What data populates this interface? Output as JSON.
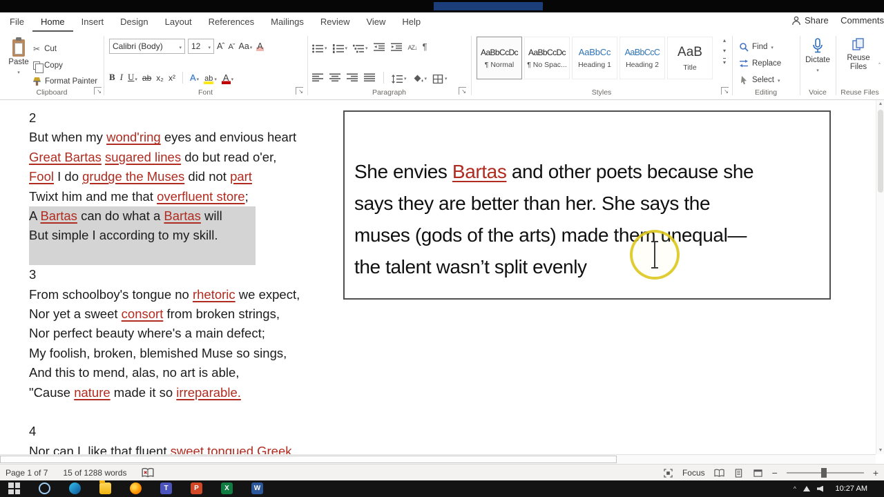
{
  "colors": {
    "red_text": "#b02b20",
    "selection_gray": "#d4d4d4",
    "circle_yellow": "#ddc81f",
    "heading_blue": "#2e74b5"
  },
  "ribbon": {
    "tabs": [
      {
        "label": "File"
      },
      {
        "label": "Home",
        "active": true
      },
      {
        "label": "Insert"
      },
      {
        "label": "Design"
      },
      {
        "label": "Layout"
      },
      {
        "label": "References"
      },
      {
        "label": "Mailings"
      },
      {
        "label": "Review"
      },
      {
        "label": "View"
      },
      {
        "label": "Help"
      }
    ],
    "share_label": "Share",
    "comments_label": "Comments",
    "group_labels": {
      "clipboard": "Clipboard",
      "font": "Font",
      "paragraph": "Paragraph",
      "styles": "Styles",
      "editing": "Editing",
      "voice": "Voice",
      "reuse": "Reuse Files"
    },
    "clipboard": {
      "paste": "Paste",
      "cut": "Cut",
      "copy": "Copy",
      "format_painter": "Format Painter"
    },
    "font": {
      "name": "Calibri (Body)",
      "size": "12"
    },
    "styles": [
      {
        "sample": "AaBbCcDc",
        "label": "¶ Normal",
        "kind": "normal",
        "selected": true
      },
      {
        "sample": "AaBbCcDc",
        "label": "¶ No Spac...",
        "kind": "normal"
      },
      {
        "sample": "AaBbCc",
        "label": "Heading 1",
        "kind": "h1"
      },
      {
        "sample": "AaBbCcC",
        "label": "Heading 2",
        "kind": "h2"
      },
      {
        "sample": "AaB",
        "label": "Title",
        "kind": "title"
      }
    ],
    "editing": {
      "find": "Find",
      "replace": "Replace",
      "select": "Select"
    },
    "voice": {
      "dictate": "Dictate"
    },
    "reuse": {
      "label": "Reuse Files"
    }
  },
  "document": {
    "lines": [
      {
        "segments": [
          {
            "t": "2"
          }
        ]
      },
      {
        "segments": [
          {
            "t": "But when my "
          },
          {
            "t": "wond'ring",
            "red": true
          },
          {
            "t": " eyes and envious heart"
          }
        ]
      },
      {
        "segments": [
          {
            "t": "Great Bartas",
            "red": true
          },
          {
            "t": " "
          },
          {
            "t": "sugared lines",
            "red": true
          },
          {
            "t": " do but read o'er,"
          }
        ]
      },
      {
        "segments": [
          {
            "t": "Fool",
            "red": true
          },
          {
            "t": " I do "
          },
          {
            "t": "grudge the Muses",
            "red": true
          },
          {
            "t": " did not "
          },
          {
            "t": "part",
            "red": true
          }
        ]
      },
      {
        "segments": [
          {
            "t": "Twixt him and me that "
          },
          {
            "t": "overfluent store",
            "red": true
          },
          {
            "t": ";"
          }
        ]
      },
      {
        "hl": true,
        "segments": [
          {
            "t": "A "
          },
          {
            "t": "Bartas",
            "red": true
          },
          {
            "t": " can do what a "
          },
          {
            "t": "Bartas",
            "red": true
          },
          {
            "t": " will"
          }
        ]
      },
      {
        "hl": true,
        "segments": [
          {
            "t": "But simple I according to my skill."
          }
        ]
      },
      {
        "hl": true,
        "blank": true,
        "segments": []
      },
      {
        "segments": [
          {
            "t": "3"
          }
        ]
      },
      {
        "segments": [
          {
            "t": "From schoolboy's tongue no "
          },
          {
            "t": "rhetoric",
            "red": true
          },
          {
            "t": " we expect,"
          }
        ]
      },
      {
        "segments": [
          {
            "t": "Nor yet a sweet "
          },
          {
            "t": "consort",
            "red": true
          },
          {
            "t": " from broken strings,"
          }
        ]
      },
      {
        "segments": [
          {
            "t": "Nor perfect beauty where's a main defect;"
          }
        ]
      },
      {
        "segments": [
          {
            "t": "My foolish, broken, blemished Muse so sings,"
          }
        ]
      },
      {
        "segments": [
          {
            "t": "And this to mend, alas, no art is able,"
          }
        ]
      },
      {
        "segments": [
          {
            "t": "\"Cause "
          },
          {
            "t": "nature",
            "red": true
          },
          {
            "t": " made it so "
          },
          {
            "t": "irreparable.",
            "red": true
          }
        ]
      },
      {
        "blank": true,
        "segments": []
      },
      {
        "segments": [
          {
            "t": "4"
          }
        ]
      },
      {
        "segments": [
          {
            "t": "Nor can I, like that fluent "
          },
          {
            "t": "sweet tongued Greek",
            "red": true
          }
        ]
      }
    ]
  },
  "textbox": {
    "lines": [
      {
        "segments": [
          {
            "t": "She envies "
          },
          {
            "t": "Bartas",
            "red": true
          },
          {
            "t": " and other poets because she"
          }
        ]
      },
      {
        "segments": [
          {
            "t": "says they are better than her. She says the"
          }
        ]
      },
      {
        "segments": [
          {
            "t": "muses (gods of the arts) made them unequal—"
          }
        ]
      },
      {
        "segments": [
          {
            "t": "the talent wasn’t split evenly"
          }
        ]
      }
    ]
  },
  "status": {
    "page": "Page 1 of 7",
    "words": "15 of 1288 words",
    "focus_label": "Focus"
  },
  "taskbar": {
    "time": "10:27 AM",
    "icons": [
      {
        "name": "start"
      },
      {
        "name": "search"
      },
      {
        "name": "edge"
      },
      {
        "name": "file-explorer"
      },
      {
        "name": "firefox"
      },
      {
        "name": "teams"
      },
      {
        "name": "powerpoint"
      },
      {
        "name": "excel"
      },
      {
        "name": "word"
      }
    ]
  }
}
